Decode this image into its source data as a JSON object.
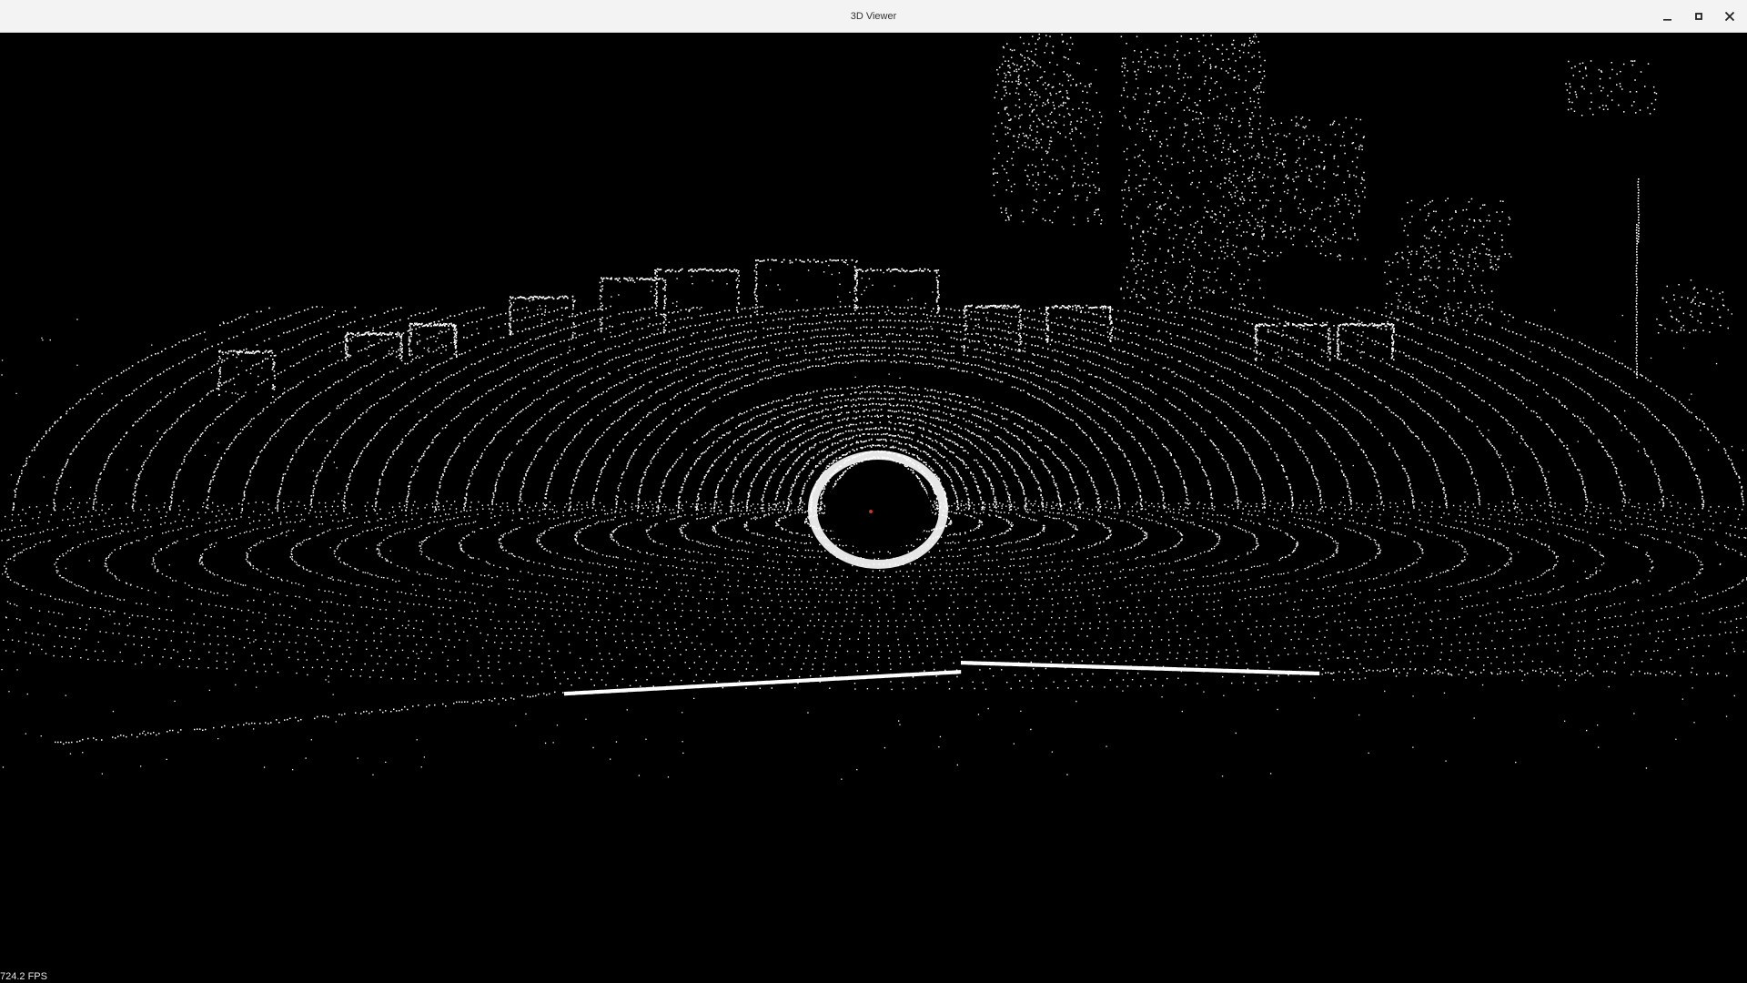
{
  "window": {
    "title": "3D Viewer"
  },
  "title_buttons": {
    "minimize_icon": "minimize-icon",
    "maximize_icon": "maximize-icon",
    "close_icon": "close-icon"
  },
  "viewer": {
    "background_color": "#000000",
    "point_color": "#ffffff",
    "fps_text": "724.2 FPS"
  }
}
